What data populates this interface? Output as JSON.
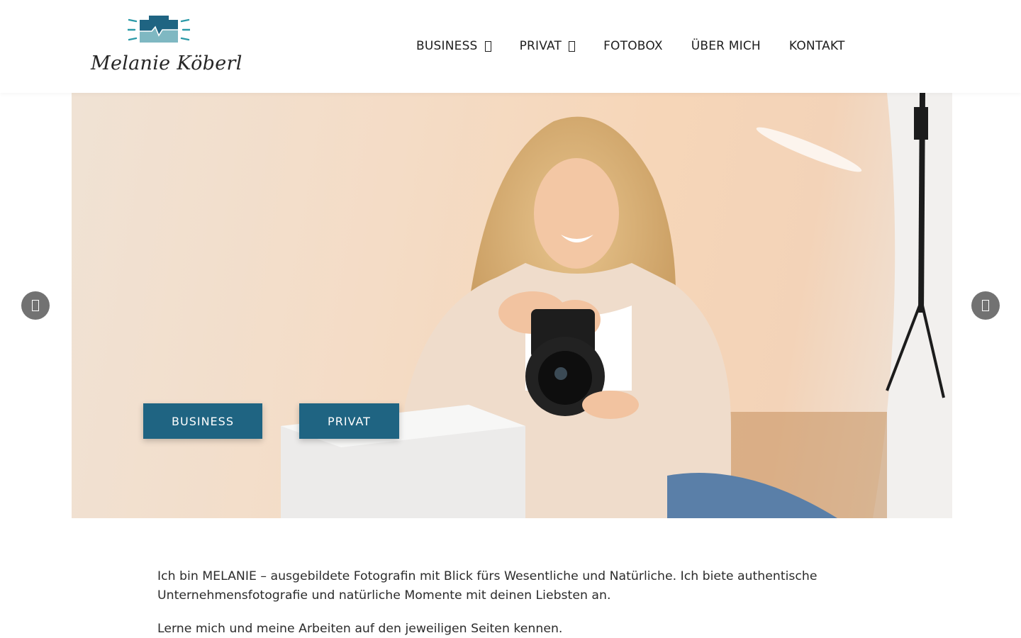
{
  "brand": {
    "name": "Melanie Köberl",
    "accent_color": "#1f6482",
    "logo_colors": [
      "#1f6482",
      "#7fb8c2",
      "#2b9aa8"
    ]
  },
  "nav": {
    "items": [
      {
        "label": "BUSINESS",
        "has_dropdown": true,
        "icon": "chevron-down-icon"
      },
      {
        "label": "PRIVAT",
        "has_dropdown": true,
        "icon": "chevron-down-icon"
      },
      {
        "label": "FOTOBOX",
        "has_dropdown": false
      },
      {
        "label": "ÜBER MICH",
        "has_dropdown": false
      },
      {
        "label": "KONTAKT",
        "has_dropdown": false
      }
    ]
  },
  "hero": {
    "buttons": {
      "business": "BUSINESS",
      "privat": "PRIVAT"
    },
    "prev_icon": "chevron-left-icon",
    "next_icon": "chevron-right-icon"
  },
  "intro": {
    "paragraph_1": "Ich bin MELANIE – ausgebildete Fotografin mit Blick fürs Wesentliche und Natürliche. Ich biete authentische Unternehmensfotografie und natürliche Momente mit deinen Liebsten an.",
    "paragraph_2": "Lerne mich und meine Arbeiten auf den jeweiligen Seiten kennen."
  }
}
